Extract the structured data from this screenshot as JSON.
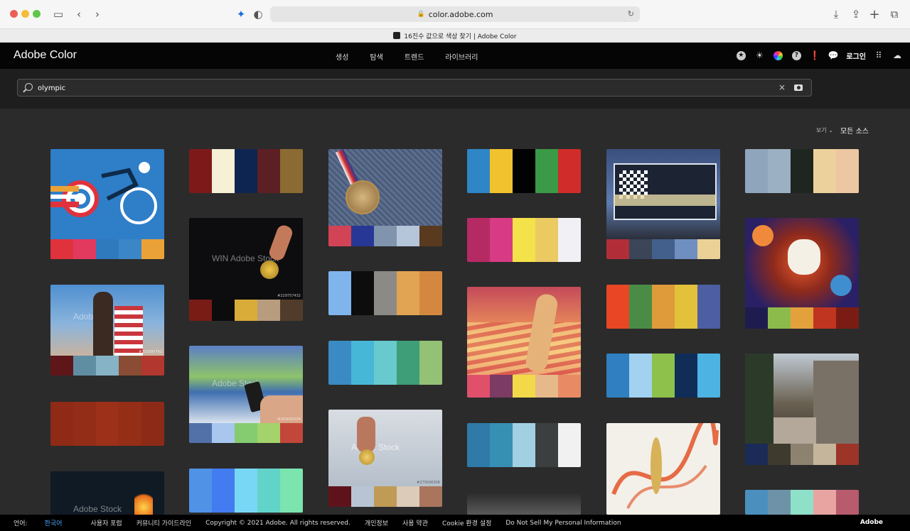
{
  "browser": {
    "url": "color.adobe.com",
    "tab_title": "16진수 값으로 색상 찾기 | Adobe Color"
  },
  "header": {
    "logo": "Adobe Color",
    "nav": [
      "생성",
      "탐색",
      "트렌드",
      "라이브러리"
    ],
    "login": "로그인",
    "icons": [
      "badge-icon",
      "brightness-icon",
      "color-wheel-icon",
      "help-icon",
      "alert-icon",
      "chat-icon",
      "apps-grid-icon",
      "creative-cloud-icon"
    ]
  },
  "search": {
    "value": "olympic"
  },
  "view": {
    "view_label": "보기",
    "source_label": "모든 소스"
  },
  "watermarks": {
    "stock": "Adobe Stock",
    "win": "WIN",
    "id1": "#331097742",
    "id2": "#229757432",
    "id3": "#263095034",
    "id4": "#275696308"
  },
  "cards": [
    {
      "colors": [
        "#e0323c",
        "#e4395e",
        "#2f79bd",
        "#3b86c6",
        "#eaa238"
      ]
    },
    {
      "colors": [
        "#7d1a19",
        "#f5f0d6",
        "#0d2550",
        "#5c1f23",
        "#8c6b33"
      ]
    },
    {
      "colors": [
        "#d24355",
        "#273795",
        "#8094ad",
        "#b5c5da",
        "#5a3a1f"
      ]
    },
    {
      "colors": [
        "#2f86c6",
        "#f2c22e",
        "#020202",
        "#3a9a47",
        "#d02c2a"
      ]
    },
    {
      "colors": [
        "#b12e38",
        "#3a4558",
        "#435f8c",
        "#6e8fc0",
        "#ecd197"
      ]
    },
    {
      "colors": [
        "#8fa5bc",
        "#9bb0c2",
        "#1f2620",
        "#edd19d",
        "#ecc7a1"
      ]
    },
    {
      "colors": [
        "#5e1619",
        "#5f8ea3",
        "#86b3c5",
        "#8a4c34",
        "#b2372e"
      ]
    },
    {
      "colors": [
        "#791c16",
        "#0c0c0c",
        "#d9ac39",
        "#b89c7e",
        "#513c2c"
      ]
    },
    {
      "colors": [
        "#7fb4ed",
        "#0d0d0d",
        "#8c8a86",
        "#e0a452",
        "#d4883f"
      ]
    },
    {
      "colors": [
        "#b62a63",
        "#d73b84",
        "#f4e24a",
        "#ecca62",
        "#f1f0f4"
      ]
    },
    {
      "colors": [
        "#e84624",
        "#4a8c45",
        "#df9a3a",
        "#e2c13b",
        "#4d5ea2"
      ]
    },
    {
      "colors": [
        "#1e1c4e",
        "#8dbb4b",
        "#e3a13c",
        "#c0351f",
        "#7b1c14"
      ]
    },
    {
      "colors": [
        "#8e2a16",
        "#932d17",
        "#9c3018",
        "#952e17",
        "#8d2a17"
      ]
    },
    {
      "colors": [
        "#5271a9",
        "#a8c6ee",
        "#85cc70",
        "#a4d36b",
        "#c2473a"
      ]
    },
    {
      "colors": [
        "#3a8bc3",
        "#47b7d8",
        "#68c9ce",
        "#3d9e77",
        "#94c175"
      ]
    },
    {
      "colors": [
        "#e0506b",
        "#7b3b63",
        "#f2d94a",
        "#e6b98b",
        "#e88b65"
      ]
    },
    {
      "colors": [
        "#2f7fc1",
        "#a2d2ef",
        "#8ec04c",
        "#0f2d57",
        "#4cb3e3"
      ]
    },
    {
      "colors": [
        "#1b2b57",
        "#3e3a2e",
        "#8d8270",
        "#c5b59b",
        "#9d3428"
      ]
    },
    {
      "colors": [
        "#4f92e6",
        "#437bf0",
        "#79d7f6",
        "#62d3c9",
        "#7ce4ae"
      ]
    },
    {
      "colors": [
        "#5e131b",
        "#b8c4d3",
        "#c09b56",
        "#dccbb8",
        "#a9755d"
      ]
    },
    {
      "colors": [
        "#2f7aa9",
        "#3690b4",
        "#a1d0e2",
        "#3b3f40",
        "#f1f1f1"
      ]
    },
    {
      "colors": [
        "#4a8fbe",
        "#6e92a8",
        "#8fe0c9",
        "#e8a4a1",
        "#b75b6d"
      ]
    }
  ],
  "footer": {
    "lang_label": "언어:",
    "lang_value": "한국어",
    "links": [
      "사용자 포럼",
      "커뮤니티 가이드라인",
      "Copyright © 2021 Adobe. All rights reserved.",
      "개인정보",
      "사용 약관",
      "Cookie 환경 설정",
      "Do Not Sell My Personal Information"
    ],
    "brand": "Adobe"
  }
}
